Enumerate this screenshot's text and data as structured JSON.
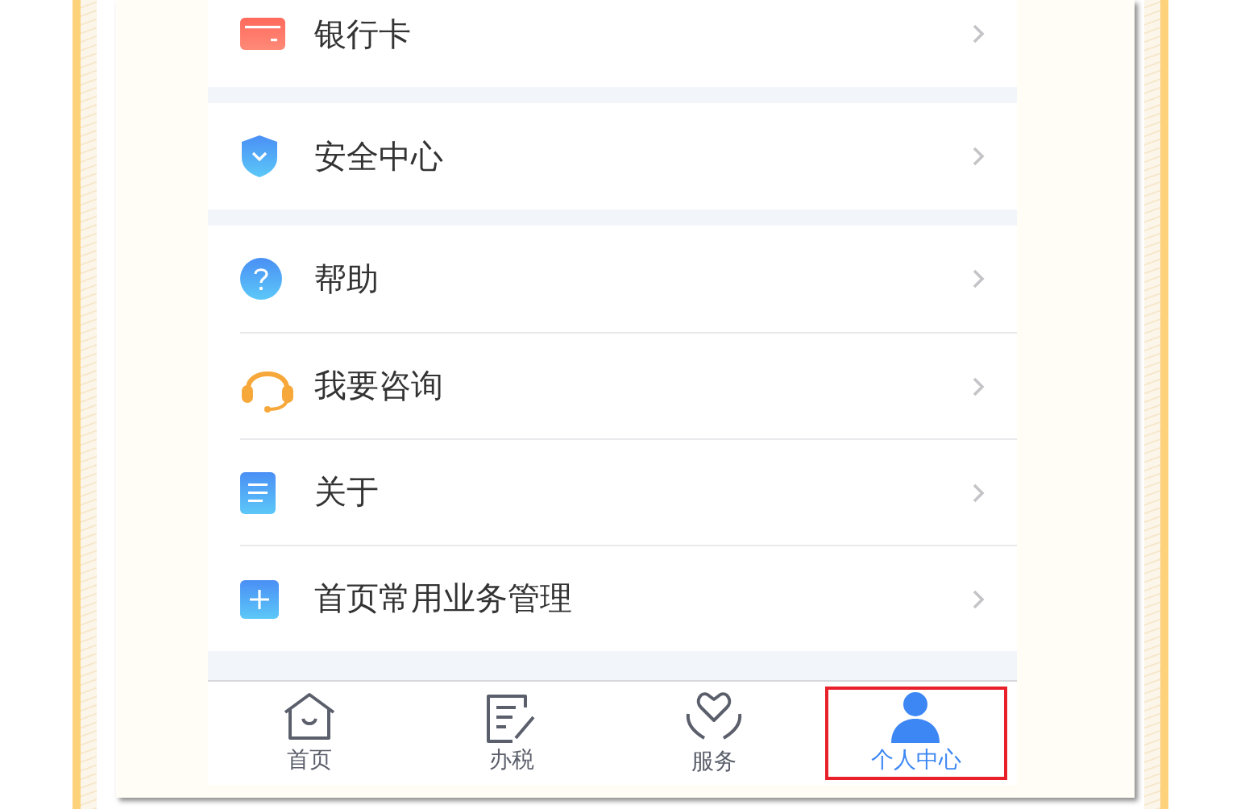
{
  "sections": [
    [
      {
        "label": "银行卡"
      }
    ],
    [
      {
        "label": "安全中心"
      }
    ],
    [
      {
        "label": "帮助"
      },
      {
        "label": "我要咨询"
      },
      {
        "label": "关于"
      },
      {
        "label": "首页常用业务管理"
      }
    ]
  ],
  "tab_bar": [
    {
      "label": "首页",
      "selected": false
    },
    {
      "label": "办税",
      "selected": false
    },
    {
      "label": "服务",
      "selected": false
    },
    {
      "label": "个人中心",
      "selected": true
    }
  ]
}
